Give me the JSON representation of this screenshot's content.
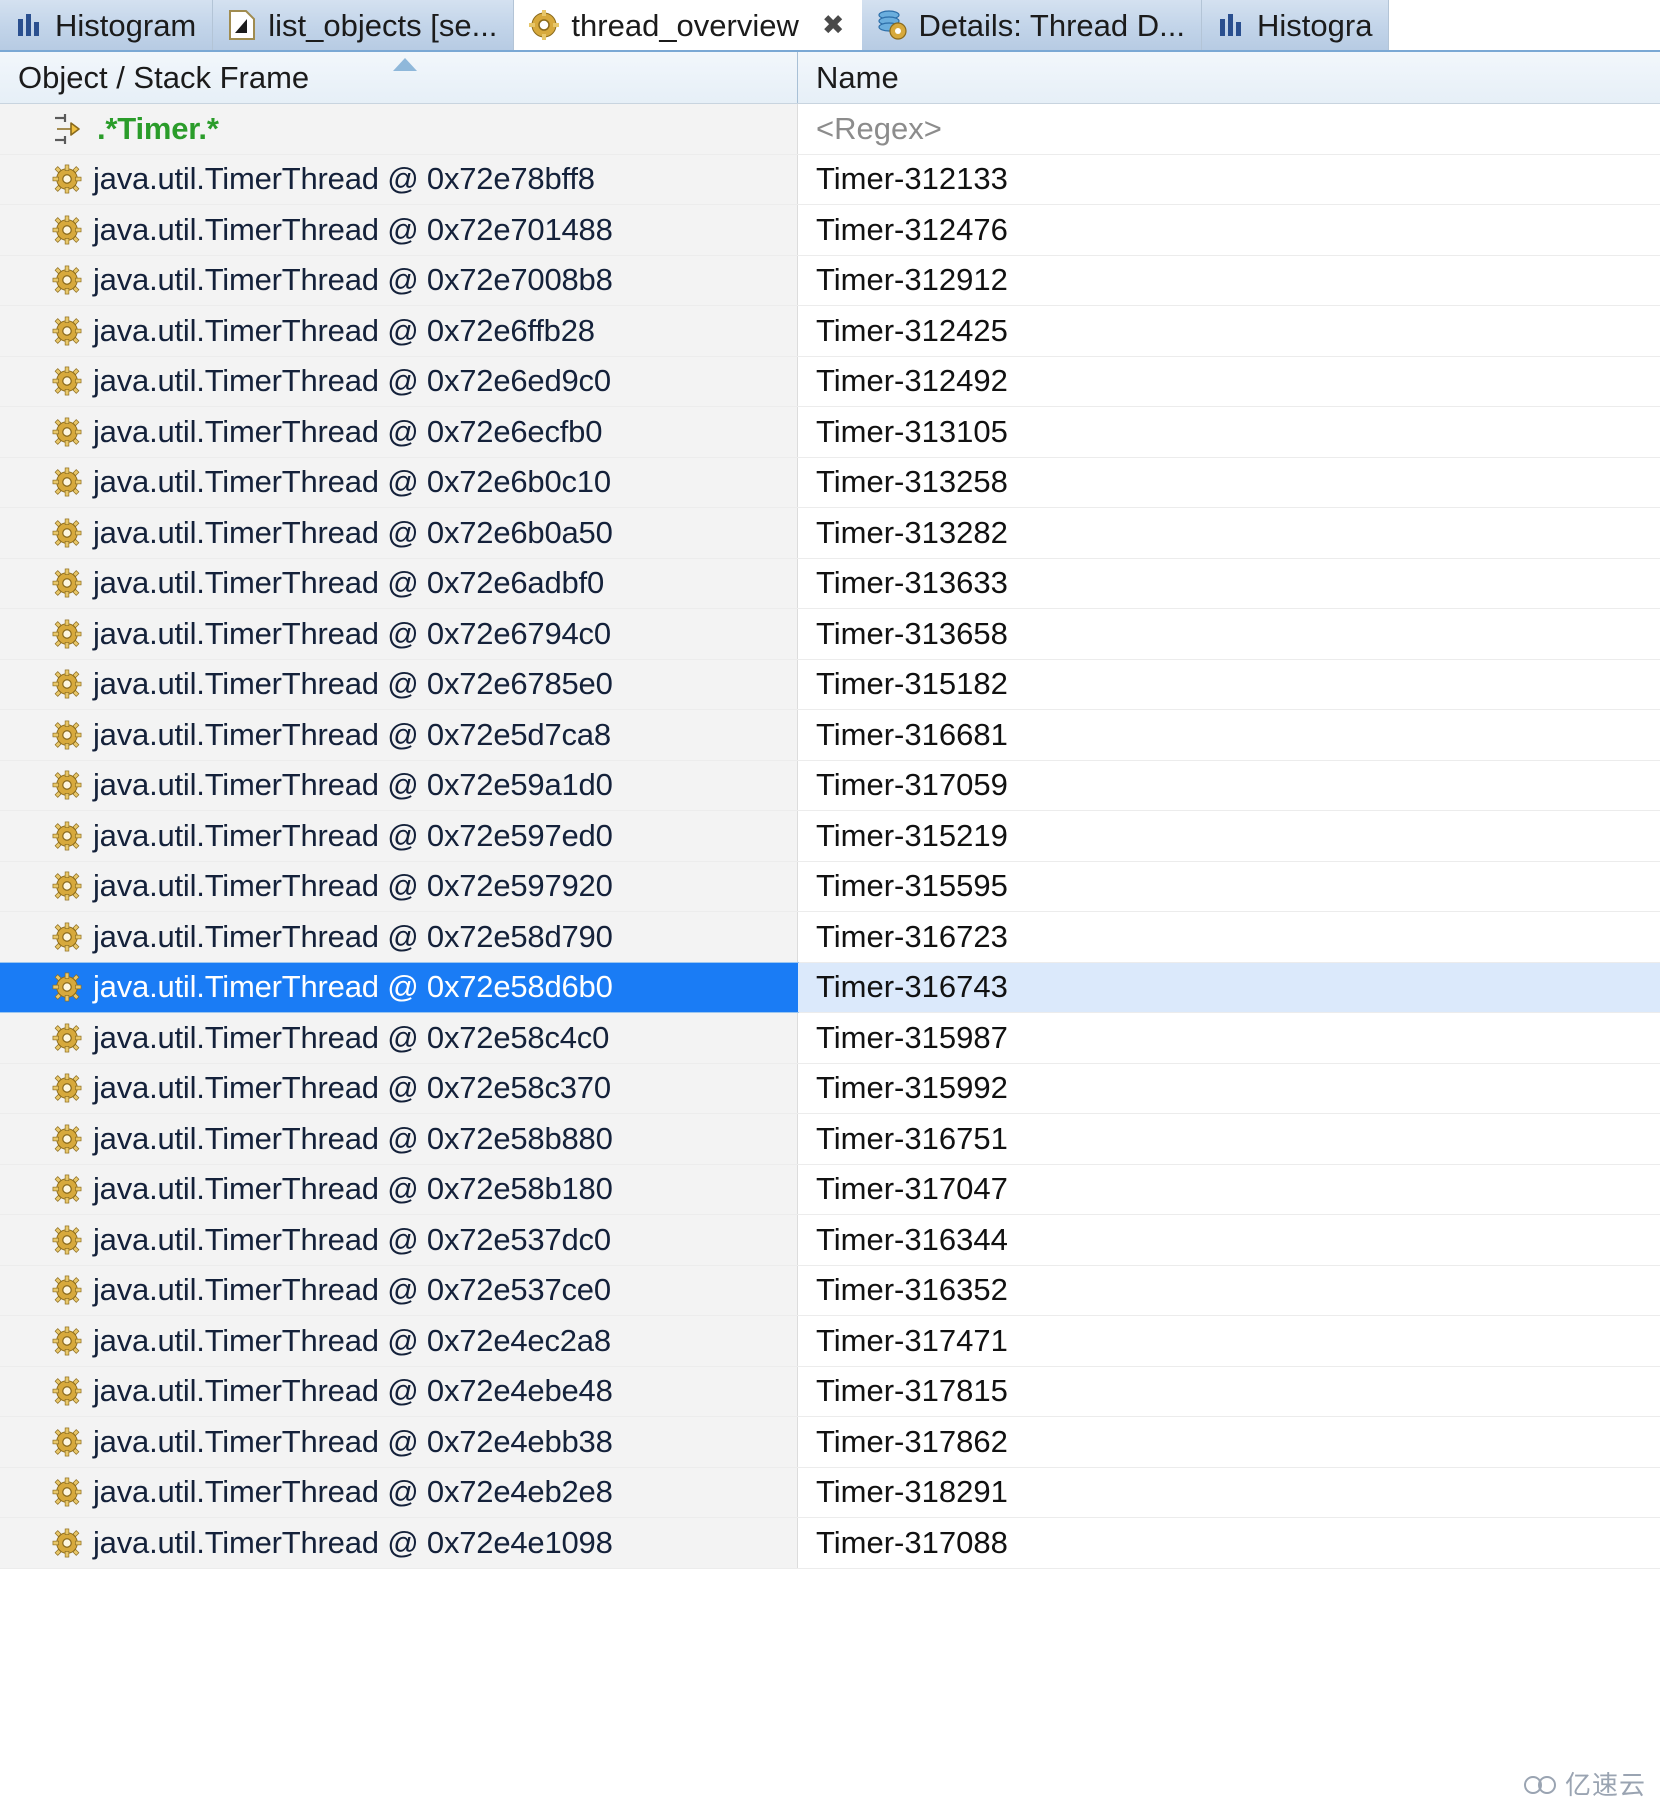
{
  "tabs": [
    {
      "label": "Histogram",
      "icon": "histogram-icon",
      "active": false,
      "closable": false
    },
    {
      "label": "list_objects  [se...",
      "icon": "document-icon",
      "active": false,
      "closable": false
    },
    {
      "label": "thread_overview",
      "icon": "gear-icon",
      "active": true,
      "closable": true,
      "close_glyph": "✖"
    },
    {
      "label": "Details: Thread D...",
      "icon": "stack-gear-icon",
      "active": false,
      "closable": false
    },
    {
      "label": "Histogra",
      "icon": "histogram-icon",
      "active": false,
      "closable": false
    }
  ],
  "columns": [
    {
      "key": "object",
      "label": "Object / Stack Frame",
      "sorted": true
    },
    {
      "key": "name",
      "label": "Name",
      "sorted": false
    }
  ],
  "filter_row": {
    "object": ".*Timer.*",
    "name": "<Regex>",
    "icon": "regex-filter-icon"
  },
  "colors": {
    "selection": "#1a7cf5",
    "selection_secondary": "#dbe9fb",
    "filter_text": "#2a9c2a",
    "placeholder_text": "#8c8c8c",
    "tab_active_bg": "#ffffff",
    "tab_inactive_bg": "#c2d4e9"
  },
  "rows": [
    {
      "object": "java.util.TimerThread @ 0x72e78bff8",
      "name": "Timer-312133",
      "selected": false
    },
    {
      "object": "java.util.TimerThread @ 0x72e701488",
      "name": "Timer-312476",
      "selected": false
    },
    {
      "object": "java.util.TimerThread @ 0x72e7008b8",
      "name": "Timer-312912",
      "selected": false
    },
    {
      "object": "java.util.TimerThread @ 0x72e6ffb28",
      "name": "Timer-312425",
      "selected": false
    },
    {
      "object": "java.util.TimerThread @ 0x72e6ed9c0",
      "name": "Timer-312492",
      "selected": false
    },
    {
      "object": "java.util.TimerThread @ 0x72e6ecfb0",
      "name": "Timer-313105",
      "selected": false
    },
    {
      "object": "java.util.TimerThread @ 0x72e6b0c10",
      "name": "Timer-313258",
      "selected": false
    },
    {
      "object": "java.util.TimerThread @ 0x72e6b0a50",
      "name": "Timer-313282",
      "selected": false
    },
    {
      "object": "java.util.TimerThread @ 0x72e6adbf0",
      "name": "Timer-313633",
      "selected": false
    },
    {
      "object": "java.util.TimerThread @ 0x72e6794c0",
      "name": "Timer-313658",
      "selected": false
    },
    {
      "object": "java.util.TimerThread @ 0x72e6785e0",
      "name": "Timer-315182",
      "selected": false
    },
    {
      "object": "java.util.TimerThread @ 0x72e5d7ca8",
      "name": "Timer-316681",
      "selected": false
    },
    {
      "object": "java.util.TimerThread @ 0x72e59a1d0",
      "name": "Timer-317059",
      "selected": false
    },
    {
      "object": "java.util.TimerThread @ 0x72e597ed0",
      "name": "Timer-315219",
      "selected": false
    },
    {
      "object": "java.util.TimerThread @ 0x72e597920",
      "name": "Timer-315595",
      "selected": false
    },
    {
      "object": "java.util.TimerThread @ 0x72e58d790",
      "name": "Timer-316723",
      "selected": false
    },
    {
      "object": "java.util.TimerThread @ 0x72e58d6b0",
      "name": "Timer-316743",
      "selected": true
    },
    {
      "object": "java.util.TimerThread @ 0x72e58c4c0",
      "name": "Timer-315987",
      "selected": false
    },
    {
      "object": "java.util.TimerThread @ 0x72e58c370",
      "name": "Timer-315992",
      "selected": false
    },
    {
      "object": "java.util.TimerThread @ 0x72e58b880",
      "name": "Timer-316751",
      "selected": false
    },
    {
      "object": "java.util.TimerThread @ 0x72e58b180",
      "name": "Timer-317047",
      "selected": false
    },
    {
      "object": "java.util.TimerThread @ 0x72e537dc0",
      "name": "Timer-316344",
      "selected": false
    },
    {
      "object": "java.util.TimerThread @ 0x72e537ce0",
      "name": "Timer-316352",
      "selected": false
    },
    {
      "object": "java.util.TimerThread @ 0x72e4ec2a8",
      "name": "Timer-317471",
      "selected": false
    },
    {
      "object": "java.util.TimerThread @ 0x72e4ebe48",
      "name": "Timer-317815",
      "selected": false
    },
    {
      "object": "java.util.TimerThread @ 0x72e4ebb38",
      "name": "Timer-317862",
      "selected": false
    },
    {
      "object": "java.util.TimerThread @ 0x72e4eb2e8",
      "name": "Timer-318291",
      "selected": false
    },
    {
      "object": "java.util.TimerThread @ 0x72e4e1098",
      "name": "Timer-317088",
      "selected": false
    }
  ],
  "watermark": {
    "text": "亿速云"
  }
}
